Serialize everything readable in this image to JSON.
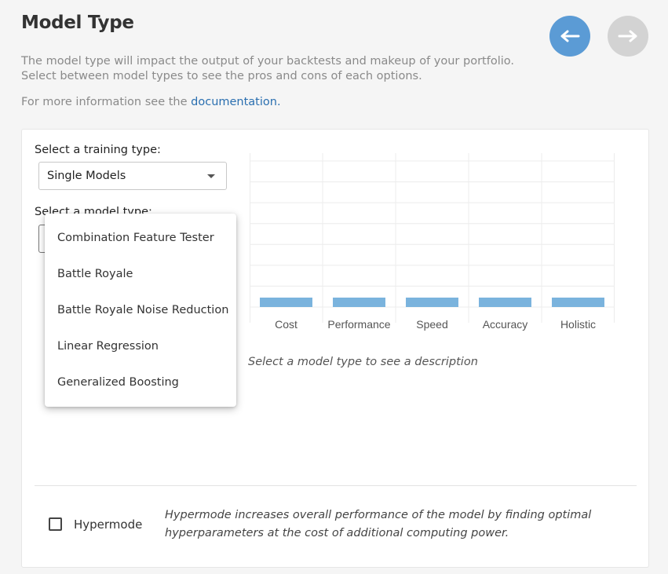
{
  "header": {
    "title": "Model Type",
    "description": "The model type will impact the output of your backtests and makeup of your portfolio. Select between model types to see the pros and cons of each options.",
    "more_info_prefix": "For more information see the ",
    "more_info_link": "documentation."
  },
  "nav": {
    "back_icon": "arrow-left-icon",
    "forward_icon": "arrow-right-icon",
    "back_color": "#5b9bd5",
    "forward_color": "#d3d3d3"
  },
  "training": {
    "label": "Select a training type:",
    "selected": "Single Models"
  },
  "model": {
    "label": "Select a model type:"
  },
  "dropdown": {
    "items": [
      "Combination Feature Tester",
      "Battle Royale",
      "Battle Royale Noise Reduction",
      "Linear Regression",
      "Generalized Boosting"
    ]
  },
  "chart_data": {
    "type": "bar",
    "categories": [
      "Cost",
      "Performance",
      "Speed",
      "Accuracy",
      "Holistic"
    ],
    "values": [
      0,
      0,
      0,
      0,
      0
    ],
    "bar_color": "#7ab3dd",
    "grid": true
  },
  "placeholder": "Select a model type to see a description",
  "hypermode": {
    "label": "Hypermode",
    "description": "Hypermode increases overall performance of the model by finding optimal hyperparameters at the cost of additional computing power."
  }
}
